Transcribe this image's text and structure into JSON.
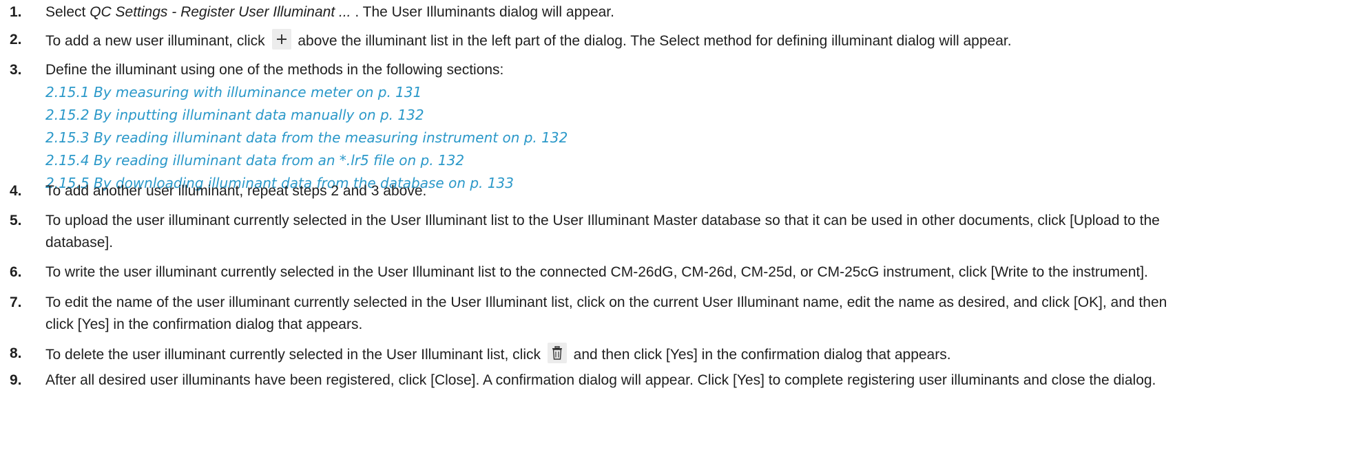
{
  "steps": [
    {
      "num": "1.",
      "pre": "Select ",
      "em": "QC Settings - Register User Illuminant ...",
      "post": " . The User Illuminants dialog will appear."
    },
    {
      "num": "2.",
      "pre": "To add a new user illuminant, click",
      "post": "above the illuminant list in the left part of the dialog. The Select method for defining illuminant dialog will appear.",
      "icon": "plus-icon"
    },
    {
      "num": "3.",
      "text": "Define the illuminant using one of the methods in the following sections:",
      "links": [
        "2.15.1 By measuring with illuminance meter on p. 131",
        "2.15.2 By inputting illuminant data manually on p. 132",
        "2.15.3 By reading illuminant data from the measuring instrument on p. 132",
        "2.15.4 By reading illuminant data from an *.lr5 file on p. 132",
        "2.15.5 By downloading illuminant data from the database on p. 133"
      ]
    },
    {
      "num": "4.",
      "text": "To add another user illuminant, repeat steps 2 and 3 above."
    },
    {
      "num": "5.",
      "line1": "To upload the user illuminant currently selected in the User Illuminant list to the User Illuminant Master database so that it can be used in other documents, click [Upload to the",
      "line2": "database]."
    },
    {
      "num": "6.",
      "text": "To write the user illuminant currently selected in the User Illuminant list to the connected CM-26dG, CM-26d, CM-25d, or CM-25cG instrument, click [Write to the instrument]."
    },
    {
      "num": "7.",
      "line1": "To edit the name of the user illuminant currently selected in the User Illuminant list, click on the current User Illuminant name, edit the name as desired, and click [OK], and then",
      "line2": "click [Yes] in the confirmation dialog that appears."
    },
    {
      "num": "8.",
      "pre": "To delete the user illuminant currently selected in the User Illuminant list, click",
      "post": "and then click [Yes] in the confirmation dialog that appears.",
      "icon": "trash-icon"
    },
    {
      "num": "9.",
      "text": "After all desired user illuminants have been registered, click [Close]. A confirmation dialog will appear. Click [Yes] to complete registering user illuminants and close the dialog."
    }
  ]
}
